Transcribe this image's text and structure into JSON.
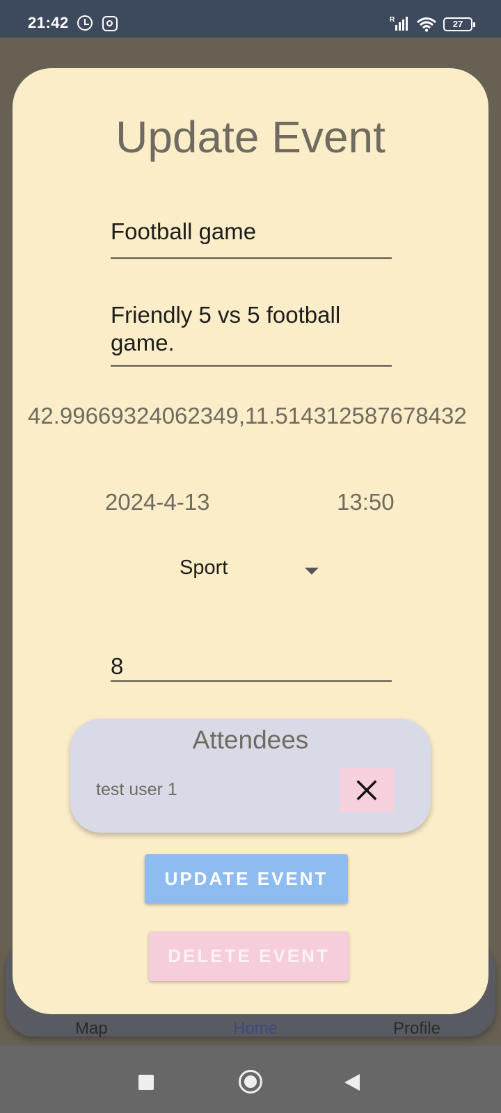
{
  "status_bar": {
    "time": "21:42",
    "battery": "27",
    "icons": [
      "alarm-icon",
      "instagram-icon",
      "signal-icon",
      "wifi-icon",
      "battery-icon"
    ]
  },
  "dialog": {
    "title": "Update Event",
    "name_value": "Football game",
    "description_value": "Friendly 5 vs 5 football game.",
    "coordinates": "42.99669324062349,11.514312587678432",
    "date": "2024-4-13",
    "time": "13:50",
    "category": "Sport",
    "capacity_value": "8",
    "attendees": {
      "title": "Attendees",
      "items": [
        {
          "name": "test user 1"
        }
      ]
    },
    "update_label": "UPDATE EVENT",
    "delete_label": "DELETE EVENT"
  },
  "bottom_nav": {
    "items": [
      {
        "label": "Map"
      },
      {
        "label": "Home"
      },
      {
        "label": "Profile"
      }
    ]
  },
  "colors": {
    "dialog_bg": "#fcedc9",
    "update_button": "#8fbcf0",
    "delete_button": "#f6cddb",
    "attendees_card": "#d8dbe7",
    "status_bar": "#3d4a5e"
  }
}
